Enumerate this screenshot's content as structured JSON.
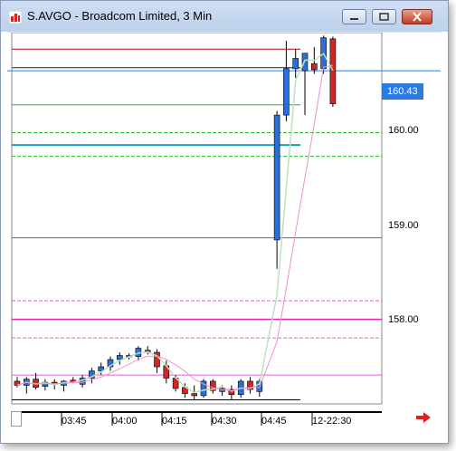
{
  "window": {
    "title": "S.AVGO - Broadcom Limited, 3 Min",
    "icons": {
      "app": "chart-app-icon",
      "minimize": "minimize-icon",
      "maximize": "maximize-icon",
      "close": "close-icon"
    }
  },
  "price_axis": {
    "labels": [
      "160.00",
      "159.00",
      "158.00"
    ],
    "current_price": "160.43"
  },
  "time_axis": {
    "labels": [
      "03:45",
      "04:00",
      "04:15",
      "04:30",
      "04:45",
      "12-22:30"
    ]
  },
  "colors": {
    "up": "#2b6fd6",
    "down": "#d42424",
    "bollinger": "#22b422",
    "bollinger_mid": "#17a2b8",
    "envelope": "#e060d0",
    "upper_band": "#c00000",
    "ma_light": "#bde0bd",
    "ma_pink": "#f28fcf"
  },
  "chart_data": {
    "type": "candlestick",
    "y_range": [
      157.2,
      160.8
    ],
    "candles": [
      {
        "o": 157.42,
        "h": 157.46,
        "l": 157.36,
        "c": 157.38
      },
      {
        "o": 157.38,
        "h": 157.46,
        "l": 157.3,
        "c": 157.44
      },
      {
        "o": 157.44,
        "h": 157.5,
        "l": 157.34,
        "c": 157.36
      },
      {
        "o": 157.37,
        "h": 157.44,
        "l": 157.33,
        "c": 157.41
      },
      {
        "o": 157.41,
        "h": 157.44,
        "l": 157.34,
        "c": 157.39
      },
      {
        "o": 157.38,
        "h": 157.43,
        "l": 157.32,
        "c": 157.42
      },
      {
        "o": 157.43,
        "h": 157.46,
        "l": 157.4,
        "c": 157.42
      },
      {
        "o": 157.39,
        "h": 157.48,
        "l": 157.36,
        "c": 157.45
      },
      {
        "o": 157.45,
        "h": 157.55,
        "l": 157.4,
        "c": 157.52
      },
      {
        "o": 157.52,
        "h": 157.6,
        "l": 157.48,
        "c": 157.56
      },
      {
        "o": 157.56,
        "h": 157.66,
        "l": 157.52,
        "c": 157.63
      },
      {
        "o": 157.63,
        "h": 157.7,
        "l": 157.58,
        "c": 157.67
      },
      {
        "o": 157.66,
        "h": 157.69,
        "l": 157.63,
        "c": 157.67
      },
      {
        "o": 157.66,
        "h": 157.76,
        "l": 157.62,
        "c": 157.74
      },
      {
        "o": 157.72,
        "h": 157.76,
        "l": 157.68,
        "c": 157.7
      },
      {
        "o": 157.7,
        "h": 157.73,
        "l": 157.5,
        "c": 157.56
      },
      {
        "o": 157.57,
        "h": 157.62,
        "l": 157.4,
        "c": 157.45
      },
      {
        "o": 157.45,
        "h": 157.48,
        "l": 157.32,
        "c": 157.35
      },
      {
        "o": 157.36,
        "h": 157.4,
        "l": 157.26,
        "c": 157.3
      },
      {
        "o": 157.3,
        "h": 157.38,
        "l": 157.24,
        "c": 157.28
      },
      {
        "o": 157.28,
        "h": 157.44,
        "l": 157.26,
        "c": 157.42
      },
      {
        "o": 157.42,
        "h": 157.44,
        "l": 157.3,
        "c": 157.33
      },
      {
        "o": 157.32,
        "h": 157.38,
        "l": 157.28,
        "c": 157.35
      },
      {
        "o": 157.34,
        "h": 157.38,
        "l": 157.24,
        "c": 157.29
      },
      {
        "o": 157.29,
        "h": 157.44,
        "l": 157.26,
        "c": 157.42
      },
      {
        "o": 157.42,
        "h": 157.46,
        "l": 157.3,
        "c": 157.34
      },
      {
        "o": 157.32,
        "h": 157.44,
        "l": 157.27,
        "c": 157.42
      },
      {
        "o": 158.79,
        "h": 160.04,
        "l": 158.51,
        "c": 160.0
      },
      {
        "o": 160.0,
        "h": 160.72,
        "l": 159.94,
        "c": 160.45
      },
      {
        "o": 160.45,
        "h": 160.64,
        "l": 160.36,
        "c": 160.55
      },
      {
        "o": 160.43,
        "h": 160.58,
        "l": 160.0,
        "c": 160.6
      },
      {
        "o": 160.5,
        "h": 160.66,
        "l": 160.4,
        "c": 160.44
      },
      {
        "o": 160.45,
        "h": 160.77,
        "l": 160.4,
        "c": 160.75
      },
      {
        "o": 160.74,
        "h": 160.76,
        "l": 160.08,
        "c": 160.11
      }
    ],
    "levels": [
      {
        "price": 160.64,
        "color": "#c00000",
        "dash": false,
        "x1": 0.0,
        "x2": 0.78
      },
      {
        "price": 160.46,
        "color": "#222222",
        "dash": false,
        "x1": 0.0,
        "x2": 0.78
      },
      {
        "price": 160.1,
        "color": "#22b422",
        "dash": false,
        "x1": 0.0,
        "x2": 0.78
      },
      {
        "price": 159.83,
        "color": "#22b422",
        "dash": true,
        "x1": 0.0,
        "x2": 1.0
      },
      {
        "price": 159.71,
        "color": "#17a2b8",
        "dash": false,
        "x1": 0.0,
        "x2": 0.78,
        "width": 2
      },
      {
        "price": 159.6,
        "color": "#22b422",
        "dash": true,
        "x1": 0.0,
        "x2": 1.0
      },
      {
        "price": 158.81,
        "color": "#666666",
        "dash": false,
        "x1": 0.0,
        "x2": 1.0
      },
      {
        "price": 158.2,
        "color": "#e060d0",
        "dash": true,
        "x1": 0.0,
        "x2": 1.0
      },
      {
        "price": 158.02,
        "color": "#e020c0",
        "dash": false,
        "x1": 0.0,
        "x2": 1.0,
        "width": 1.5
      },
      {
        "price": 157.84,
        "color": "#e060d0",
        "dash": true,
        "x1": 0.0,
        "x2": 1.0
      },
      {
        "price": 157.48,
        "color": "#e060d0",
        "dash": false,
        "x1": 0.0,
        "x2": 1.0
      },
      {
        "price": 157.24,
        "color": "#000000",
        "dash": false,
        "x1": 0.0,
        "x2": 0.78
      }
    ]
  }
}
